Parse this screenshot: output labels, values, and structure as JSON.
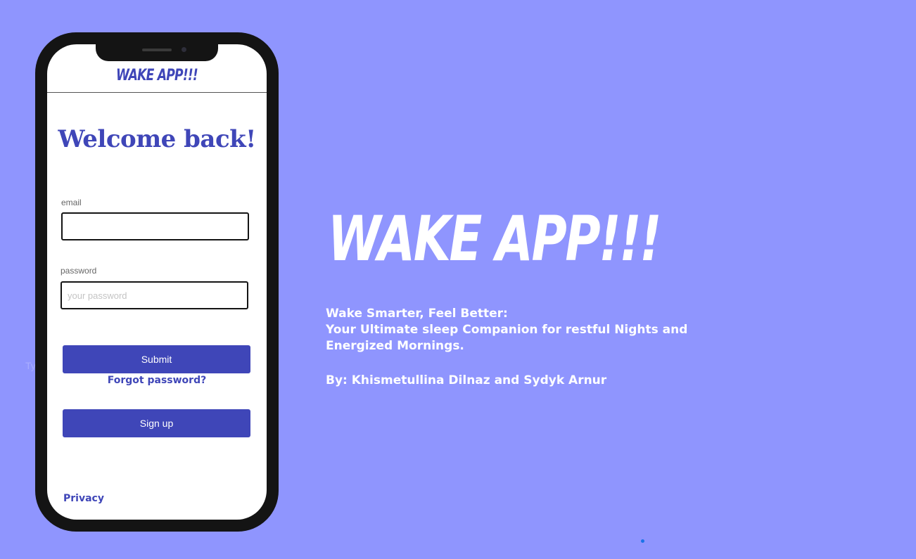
{
  "background_text": "Ty   so",
  "phone": {
    "app_title": "WAKE APP!!!",
    "welcome": "Welcome back!",
    "email": {
      "label": "email",
      "value": "",
      "placeholder": ""
    },
    "password": {
      "label": "password",
      "value": "",
      "placeholder": "your password"
    },
    "submit_label": "Submit",
    "forgot_label": "Forgot password?",
    "signup_label": "Sign up",
    "privacy_label": "Privacy"
  },
  "hero": {
    "title": "WAKE APP!!!",
    "tagline_1": "Wake Smarter, Feel Better:",
    "tagline_2": "Your Ultimate sleep Companion for restful Nights and Energized Mornings.",
    "authors": "By: Khismetullina Dilnaz and Sydyk Arnur"
  },
  "colors": {
    "background": "#8f95fe",
    "accent": "#3f46b8",
    "phone_frame": "#141414",
    "text_light": "#ffffff"
  }
}
